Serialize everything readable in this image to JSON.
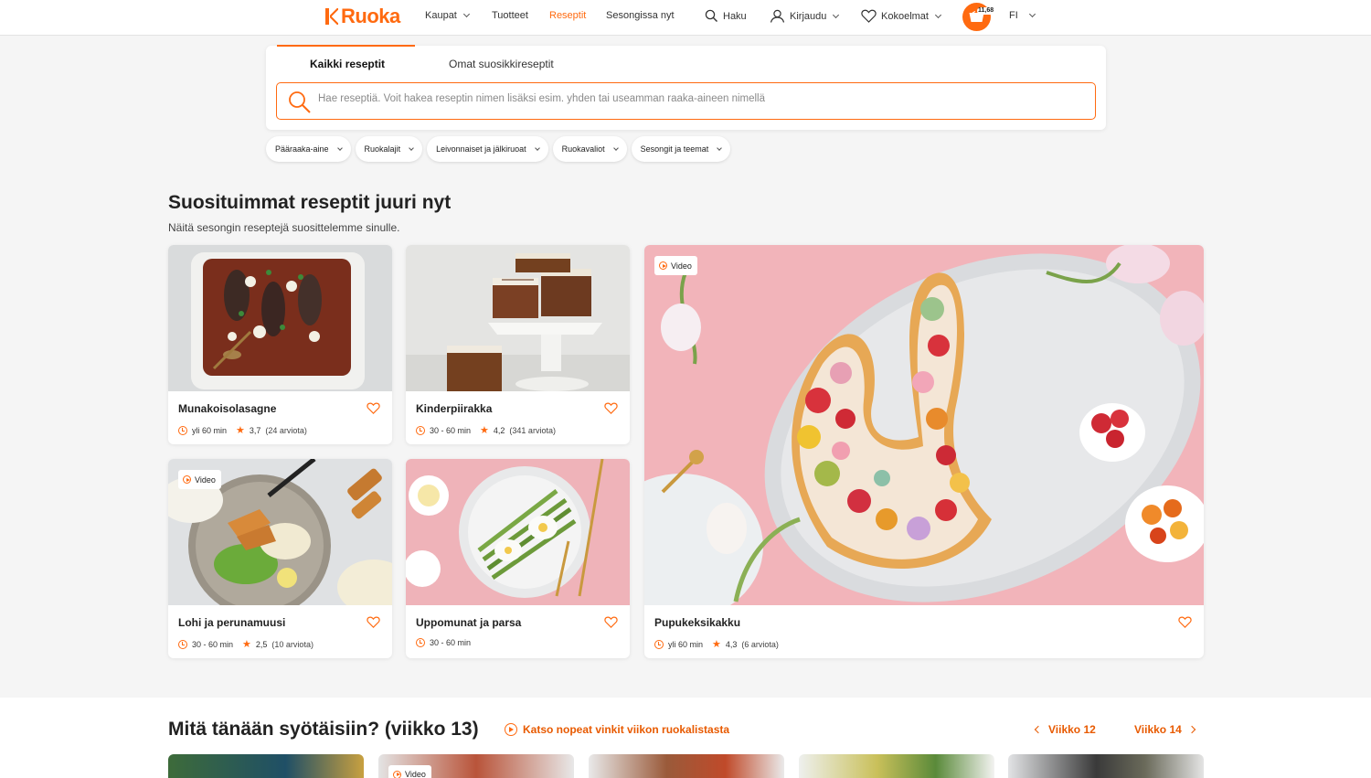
{
  "nav": {
    "logo": "Ruoka",
    "items": [
      {
        "label": "Kaupat",
        "dropdown": true,
        "active": false
      },
      {
        "label": "Tuotteet",
        "dropdown": false,
        "active": false
      },
      {
        "label": "Reseptit",
        "dropdown": false,
        "active": true
      },
      {
        "label": "Sesongissa nyt",
        "dropdown": false,
        "active": false
      }
    ],
    "search_label": "Haku",
    "login_label": "Kirjaudu",
    "collections_label": "Kokoelmat",
    "basket_total": "11,68",
    "language": "FI",
    "accent": "#ff6a10"
  },
  "search": {
    "tabs": [
      "Kaikki reseptit",
      "Omat suosikkireseptit"
    ],
    "active_tab": 0,
    "placeholder": "Hae reseptiä. Voit hakea reseptin nimen lisäksi esim. yhden tai useamman raaka-aineen nimellä",
    "value": ""
  },
  "filters": [
    "Pääraaka-aine",
    "Ruokalajit",
    "Leivonnaiset ja jälkiruoat",
    "Ruokavaliot",
    "Sesongit ja teemat"
  ],
  "popular": {
    "title": "Suosituimmat reseptit juuri nyt",
    "subtitle": "Näitä sesongin reseptejä suosittelemme sinulle.",
    "recipes": [
      {
        "title": "Munakoisolasagne",
        "time": "yli 60 min",
        "rating": "3,7",
        "reviews": "(24 arviota)",
        "video": false
      },
      {
        "title": "Kinderpiirakka",
        "time": "30 - 60 min",
        "rating": "4,2",
        "reviews": "(341 arviota)",
        "video": false
      },
      {
        "title": "Pupukeksikakku",
        "time": "yli 60 min",
        "rating": "4,3",
        "reviews": "(6 arviota)",
        "video": true
      },
      {
        "title": "Lohi ja perunamuusi",
        "time": "30 - 60 min",
        "rating": "2,5",
        "reviews": "(10 arviota)",
        "video": true
      },
      {
        "title": "Uppomunat ja parsa",
        "time": "30 - 60 min",
        "rating": "",
        "reviews": "",
        "video": false
      }
    ],
    "video_label": "Video"
  },
  "weekly": {
    "title": "Mitä tänään syötäisiin? (viikko 13)",
    "tips_link": "Katso nopeat vinkit viikon ruokalistasta",
    "prev_week": "Viikko 12",
    "next_week": "Viikko 14",
    "video_label": "Video"
  }
}
